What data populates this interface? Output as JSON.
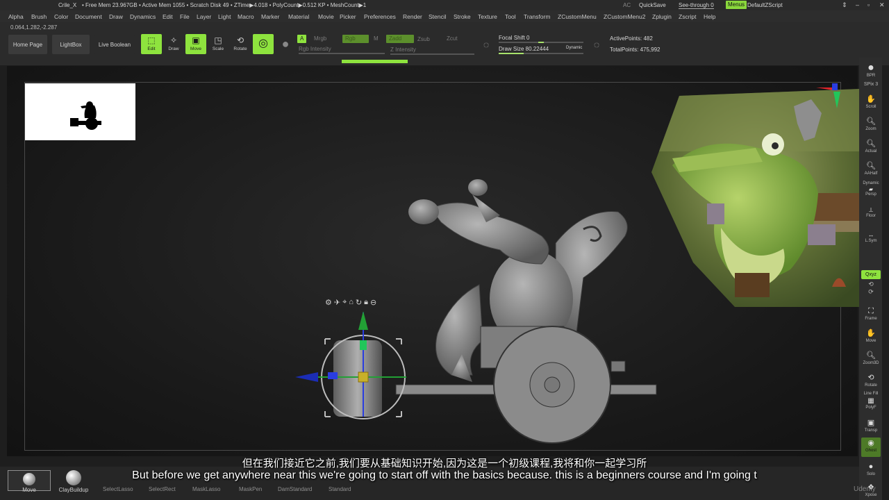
{
  "title": {
    "app": "Crile_X",
    "stats": "• Free Mem 23.967GB • Active Mem 1055 • Scratch Disk 49 •  ZTime▶4.018 • PolyCount▶0.512 KP • MeshCount▶1",
    "ac": "AC",
    "quicksave": "QuickSave",
    "seethrough": "See-through  0",
    "menus": "Menus",
    "defaultzscript": "DefaultZScript"
  },
  "menu": [
    "Alpha",
    "Brush",
    "Color",
    "Document",
    "Draw",
    "Dynamics",
    "Edit",
    "File",
    "Layer",
    "Light",
    "Macro",
    "Marker",
    "Material",
    "Movie",
    "Picker",
    "Preferences",
    "Render",
    "Stencil",
    "Stroke",
    "Texture",
    "Tool",
    "Transform",
    "ZCustomMenu",
    "ZCustomMenu2",
    "Zplugin",
    "Zscript",
    "Help"
  ],
  "coords": "0.064,1.282,-2.287",
  "toolbar": {
    "home": "Home Page",
    "lightbox": "LightBox",
    "liveboolean": "Live Boolean",
    "edit": "Edit",
    "draw": "Draw",
    "move": "Move",
    "scale": "Scale",
    "rotate": "Rotate",
    "a": "A",
    "mrgb": "Mrgb",
    "rgb": "Rgb",
    "m": "M",
    "zadd": "Zadd",
    "zsub": "Zsub",
    "zcut": "Zcut",
    "rgb_intensity": "Rgb Intensity",
    "z_intensity": "Z Intensity",
    "focal_shift": "Focal Shift 0",
    "draw_size": "Draw Size 80.22444",
    "dynamic": "Dynamic",
    "active_points": "ActivePoints: 482",
    "total_points": "TotalPoints: 475,992"
  },
  "shelf_right": [
    {
      "label": "BPR",
      "icon": "sphere-icon"
    },
    {
      "label": "SPix 3",
      "icon": ""
    },
    {
      "label": "Scroll",
      "icon": "hand-icon"
    },
    {
      "label": "Zoom",
      "icon": "magnifier-icon"
    },
    {
      "label": "Actual",
      "icon": "magnifier-icon"
    },
    {
      "label": "AAHalf",
      "icon": "magnifier-icon"
    },
    {
      "label": "Persp",
      "icon": "perspective-icon"
    },
    {
      "label": "Floor",
      "icon": "floor-icon"
    },
    {
      "label": "L.Sym",
      "icon": "symmetry-icon"
    },
    {
      "label": "Qxyz",
      "icon": "axis-icon"
    },
    {
      "label": "Frame",
      "icon": "frame-icon"
    },
    {
      "label": "Move",
      "icon": "hand-icon"
    },
    {
      "label": "Zoom3D",
      "icon": "magnifier-icon"
    },
    {
      "label": "Rotate",
      "icon": "rotate-icon"
    },
    {
      "label": "PolyF",
      "icon": "polyframe-icon"
    },
    {
      "label": "Transp",
      "icon": "transparency-icon"
    },
    {
      "label": "Ghost",
      "icon": "ghost-icon"
    },
    {
      "label": "Solo",
      "icon": "solo-icon"
    },
    {
      "label": "Xpose",
      "icon": "xpose-icon"
    }
  ],
  "shelf_right_extra": {
    "dynamic": "Dynamic",
    "linefill": "Line Fill"
  },
  "bottom": {
    "move": "Move",
    "claybuildup": "ClayBuildup",
    "selectlasso": "SelectLasso",
    "selectrect": "SelectRect",
    "masklasso": "MaskLasso",
    "maskpen": "MaskPen",
    "damstandard": "DamStandard",
    "standard": "Standard"
  },
  "gizmo_icons": [
    "gear-icon",
    "pin-icon",
    "location-icon",
    "home-icon",
    "reset-icon",
    "lock-icon",
    "minus-icon"
  ],
  "subtitles": {
    "cn": "但在我们接近它之前,我们要从基础知识开始,因为这是一个初级课程,我将和你一起学习所",
    "en": "But before we get anywhere near this we're going to start off with the basics because. this is a beginners course and I'm going t"
  },
  "watermark": "Udemy",
  "colors": {
    "accent": "#8ee33e",
    "background": "#1e1e1e"
  }
}
